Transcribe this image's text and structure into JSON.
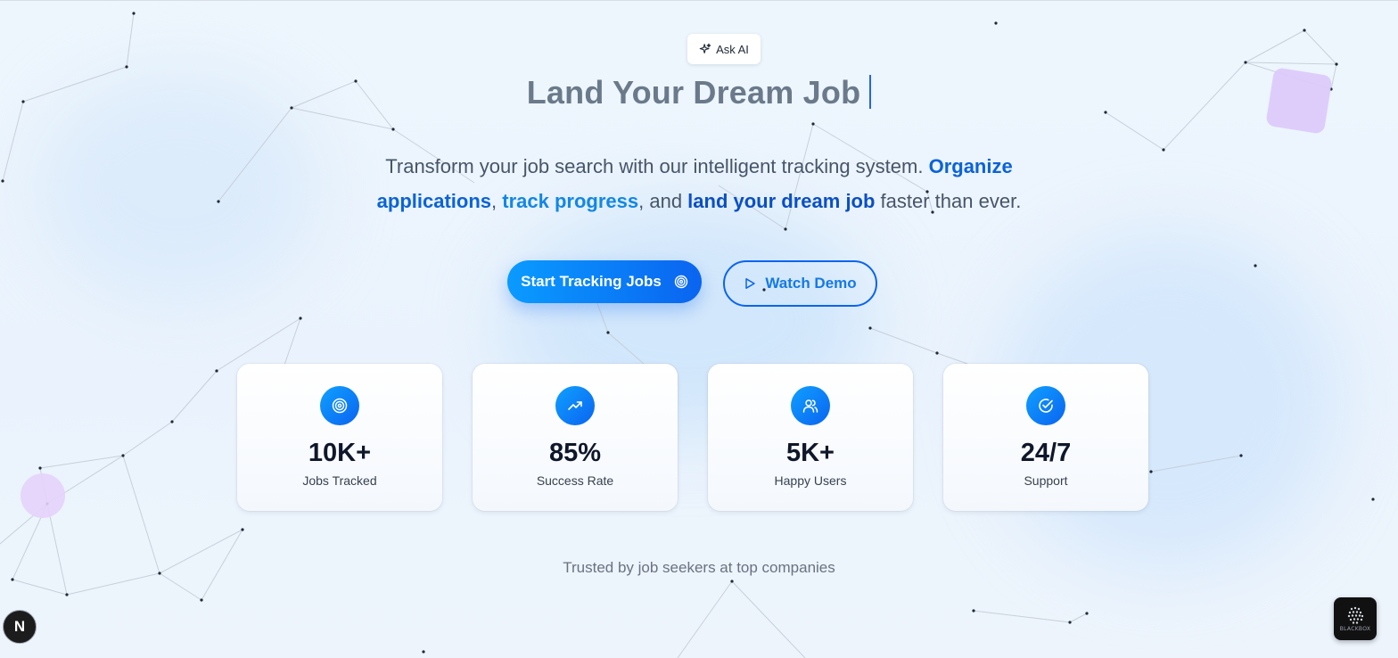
{
  "ask_ai": {
    "label": "Ask AI",
    "icon": "sparkle-icon"
  },
  "hero": {
    "title": "Land Your Dream Job"
  },
  "subtitle": {
    "part1": "Transform your job search with our intelligent tracking system. ",
    "hl1": "Organize applications",
    "sep1": ", ",
    "hl2": "track progress",
    "sep2": ", and ",
    "hl3": "land your dream job",
    "part2": " faster than ever."
  },
  "buttons": {
    "primary_label": "Start Tracking Jobs",
    "primary_icon": "target-icon",
    "secondary_label": "Watch Demo",
    "secondary_icon": "play-icon"
  },
  "stats": [
    {
      "value": "10K+",
      "label": "Jobs Tracked",
      "icon": "target-icon"
    },
    {
      "value": "85%",
      "label": "Success Rate",
      "icon": "trending-up-icon"
    },
    {
      "value": "5K+",
      "label": "Happy Users",
      "icon": "users-icon"
    },
    {
      "value": "24/7",
      "label": "Support",
      "icon": "check-circle-icon"
    }
  ],
  "trusted": "Trusted by job seekers at top companies",
  "badges": {
    "next": "N",
    "blackbox": "BLACKBOX"
  },
  "colors": {
    "accent": "#0a64f0",
    "accent_light": "#0a9bff",
    "title_gray": "#6b7a8a",
    "highlight_blue": "#0b63d8"
  }
}
